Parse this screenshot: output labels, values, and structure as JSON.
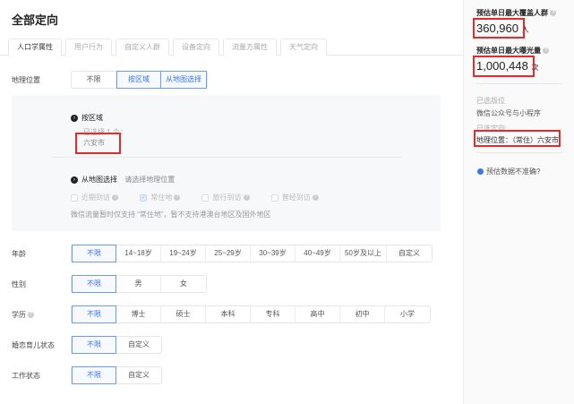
{
  "title": "全部定向",
  "tabs": [
    "人口学属性",
    "用户行为",
    "自定义人群",
    "设备定向",
    "流量方属性",
    "天气定向"
  ],
  "geo": {
    "label": "地理位置",
    "options": [
      "不限",
      "按区域",
      "从地图选择"
    ],
    "region_heading": "按区域",
    "selected_count": "已选择 1 个：",
    "selected_city": "六安市",
    "map_heading": "从地图选择",
    "map_placeholder": "请选择地理位置",
    "checkboxes": [
      "近期到访",
      "常住地",
      "旅行到访",
      "曾经到访"
    ],
    "note": "微信流量暂时仅支持 “常住地”，暂不支持港澳台地区及国外地区"
  },
  "age": {
    "label": "年龄",
    "options": [
      "不限",
      "14~18岁",
      "19~24岁",
      "25~29岁",
      "30~39岁",
      "40~49岁",
      "50岁及以上",
      "自定义"
    ]
  },
  "gender": {
    "label": "性别",
    "options": [
      "不限",
      "男",
      "女"
    ]
  },
  "education": {
    "label": "学历",
    "options": [
      "不限",
      "博士",
      "硕士",
      "本科",
      "专科",
      "高中",
      "初中",
      "小学"
    ]
  },
  "marriage": {
    "label": "婚恋育儿状态",
    "options": [
      "不限",
      "自定义"
    ]
  },
  "work": {
    "label": "工作状态",
    "options": [
      "不限",
      "自定义"
    ]
  },
  "side": {
    "reach_label": "预估单日最大覆盖人群",
    "reach_value": "360,960",
    "reach_unit": "人",
    "exposure_label": "预估单日最大曝光量",
    "exposure_value": "1,000,448",
    "exposure_unit": "次",
    "placement_label": "已选版位",
    "placement_value": "微信公众号与小程序",
    "targeting_label": "已选定向:",
    "targeting_value": "地理位置：（常住）六安市",
    "feedback": "预估数据不准确?"
  }
}
